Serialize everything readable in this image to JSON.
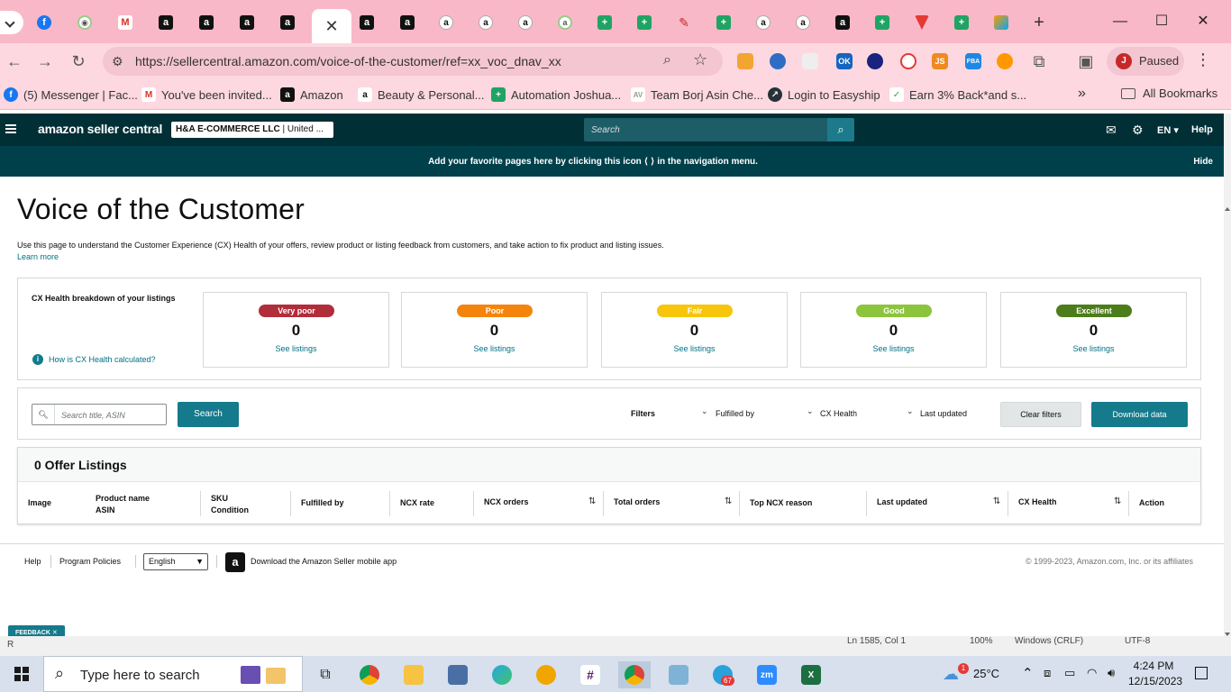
{
  "browser": {
    "tabs": [
      {
        "icon": "facebook-icon"
      },
      {
        "icon": "app-icon"
      },
      {
        "icon": "gmail-icon"
      },
      {
        "icon": "amazon-icon"
      },
      {
        "icon": "amazon-icon"
      },
      {
        "icon": "amazon-icon"
      },
      {
        "icon": "amazon-icon"
      },
      {
        "icon": "close-icon",
        "active": true
      },
      {
        "icon": "amazon-icon"
      },
      {
        "icon": "amazon-icon"
      },
      {
        "icon": "amazon-smile-icon"
      },
      {
        "icon": "amazon-smile-icon"
      },
      {
        "icon": "amazon-smile-icon"
      },
      {
        "icon": "circle-icon"
      },
      {
        "icon": "sheets-icon"
      },
      {
        "icon": "sheets-icon"
      },
      {
        "icon": "pencil-icon"
      },
      {
        "icon": "sheets-icon"
      },
      {
        "icon": "amazon-smile-icon"
      },
      {
        "icon": "amazon-smile-icon"
      },
      {
        "icon": "amazon-icon"
      },
      {
        "icon": "sheets-icon"
      },
      {
        "icon": "red-triangle-icon"
      },
      {
        "icon": "sheets-icon"
      },
      {
        "icon": "multicolor-icon"
      }
    ],
    "new_tab": "+",
    "window_controls": {
      "minimize": "—",
      "maximize": "☐",
      "close": "✕"
    },
    "url": "https://sellercentral.amazon.com/voice-of-the-customer/ref=xx_voc_dnav_xx",
    "profile": {
      "initial": "J",
      "label": "Paused"
    },
    "extension_labels": {
      "ok": "OK",
      "js": "JS",
      "fba": "FBA"
    },
    "bookmarks": [
      {
        "label": "(5) Messenger | Fac...",
        "icon": "facebook-icon"
      },
      {
        "label": "You've been invited...",
        "icon": "gmail-icon"
      },
      {
        "label": "Amazon",
        "icon": "amazon-icon"
      },
      {
        "label": "Beauty & Personal...",
        "icon": "amazon-smile-icon"
      },
      {
        "label": "Automation Joshua...",
        "icon": "sheets-icon"
      },
      {
        "label": "Team Borj Asin Che...",
        "icon": "app-icon"
      },
      {
        "label": "Login to Easyship",
        "icon": "easyship-icon"
      },
      {
        "label": "Earn 3% Back*and s...",
        "icon": "cashback-icon"
      }
    ],
    "all_bookmarks": "All Bookmarks",
    "more": "»"
  },
  "seller_central": {
    "logo": "amazon seller central",
    "store_name": "H&A E-COMMERCE LLC",
    "store_region": " | United ...",
    "search_placeholder": "Search",
    "language": "EN",
    "help": "Help",
    "banner": "Add your favorite pages here by clicking this icon ⟨ ⟩ in the navigation menu.",
    "banner_hide": "Hide"
  },
  "page": {
    "title": "Voice of the Customer",
    "description": "Use this page to understand the Customer Experience (CX) Health of your offers, review product or listing feedback from customers, and take action to fix product and listing issues.",
    "learn_more": "Learn more",
    "cx_heading": "CX Health breakdown of your listings",
    "cx_help": "How is CX Health calculated?",
    "cx_levels": [
      {
        "label": "Very poor",
        "count": "0",
        "link": "See listings",
        "color": "#b12d3b"
      },
      {
        "label": "Poor",
        "count": "0",
        "link": "See listings",
        "color": "#f5840c"
      },
      {
        "label": "Fair",
        "count": "0",
        "link": "See listings",
        "color": "#f7c50b"
      },
      {
        "label": "Good",
        "count": "0",
        "link": "See listings",
        "color": "#8cc43c"
      },
      {
        "label": "Excellent",
        "count": "0",
        "link": "See listings",
        "color": "#4d7d1a"
      }
    ],
    "filters": {
      "search_placeholder": "Search title, ASIN",
      "search_button": "Search",
      "label": "Filters",
      "fulfilled_by": "Fulfilled by",
      "cx_health": "CX Health",
      "last_updated": "Last updated",
      "clear": "Clear filters",
      "download": "Download data"
    },
    "table": {
      "title": "0 Offer Listings",
      "columns": {
        "image": "Image",
        "product_name": "Product name",
        "asin": "ASIN",
        "sku": "SKU",
        "condition": "Condition",
        "fulfilled_by": "Fulfilled by",
        "ncx_rate": "NCX rate",
        "ncx_orders": "NCX orders",
        "total_orders": "Total orders",
        "top_ncx_reason": "Top NCX reason",
        "last_updated": "Last updated",
        "cx_health": "CX Health",
        "action": "Action"
      }
    }
  },
  "footer": {
    "help": "Help",
    "policies": "Program Policies",
    "language": "English",
    "app": "Download the Amazon Seller mobile app",
    "copyright": "© 1999-2023, Amazon.com, Inc. or its affiliates"
  },
  "feedback": "FEEDBACK ✕",
  "background_window": {
    "pos": "Ln 1585, Col 1",
    "zoom": "100%",
    "eol": "Windows (CRLF)",
    "enc": "UTF-8",
    "r": "R"
  },
  "taskbar": {
    "search_placeholder": "Type here to search",
    "weather": "25°C",
    "weather_badge": "1",
    "time": "4:24 PM",
    "date": "12/15/2023",
    "telegram_badge": "67",
    "zoom_label": "zm"
  }
}
